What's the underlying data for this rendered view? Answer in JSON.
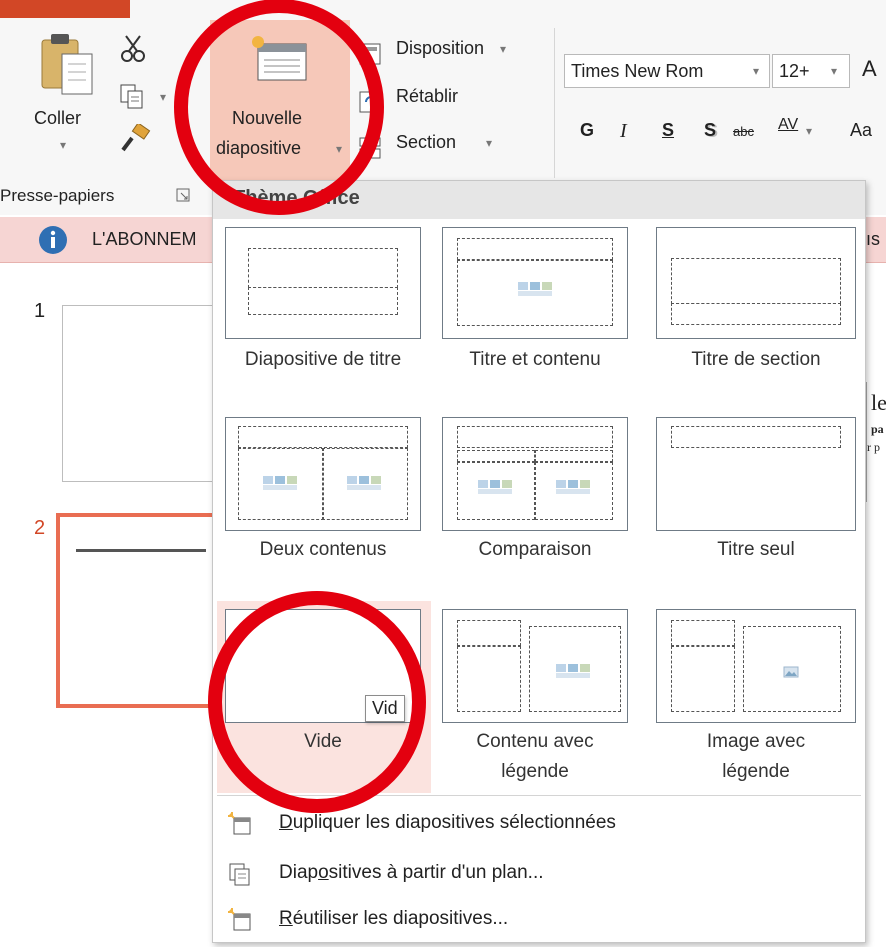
{
  "ribbon": {
    "paste": {
      "label": "Coller"
    },
    "new_slide": {
      "line1": "Nouvelle",
      "line2": "diapositive"
    },
    "layout_label": "Disposition",
    "reset_label": "Rétablir",
    "section_label": "Section",
    "clipboard_group": "Presse-papiers",
    "font_name": "Times New Rom",
    "font_size": "12+",
    "grow_font": "A",
    "bold": "G",
    "italic": "I",
    "underline": "S",
    "shadow": "S",
    "strike": "abc",
    "spacing": "AV",
    "change_case": "Aa"
  },
  "notification": {
    "text": "L'ABONNEM",
    "right_text": "ıs"
  },
  "slides": [
    {
      "number": "1"
    },
    {
      "number": "2"
    }
  ],
  "behind_text": {
    "line1": "le",
    "line2": "pa",
    "line3": "r p"
  },
  "menu": {
    "header": "Thème Office",
    "layouts": [
      {
        "name": "Diapositive de titre"
      },
      {
        "name": "Titre et contenu"
      },
      {
        "name": "Titre de section"
      },
      {
        "name": "Deux contenus"
      },
      {
        "name": "Comparaison"
      },
      {
        "name": "Titre seul"
      },
      {
        "name": "Vide"
      },
      {
        "name_line1": "Contenu avec",
        "name_line2": "légende"
      },
      {
        "name_line1": "Image avec",
        "name_line2": "légende"
      }
    ],
    "tooltip": "Vid",
    "items": [
      {
        "underlined": "D",
        "rest": "upliquer les diapositives sélectionnées"
      },
      {
        "pre": "Diap",
        "underlined": "o",
        "rest": "sitives à partir d'un plan..."
      },
      {
        "underlined": "R",
        "rest": "éutiliser les diapositives..."
      }
    ]
  },
  "colors": {
    "accent": "#d24726",
    "annotation": "#e3000f",
    "hover": "#fbe3df",
    "notification": "#f6d5d3"
  }
}
